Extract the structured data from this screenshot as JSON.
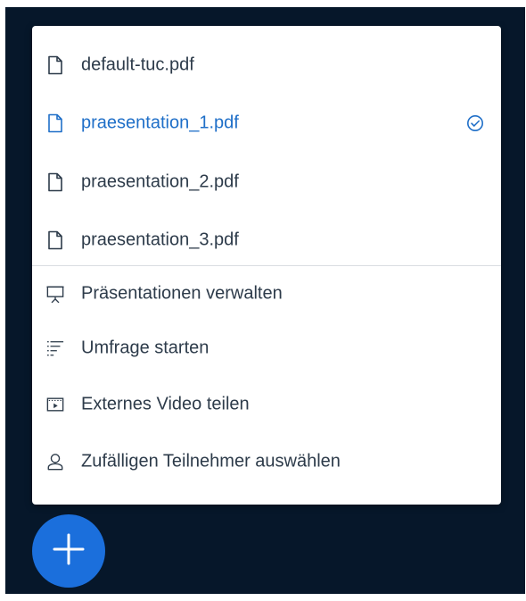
{
  "presentations": [
    {
      "name": "default-tuc.pdf",
      "icon": "file-icon",
      "active": false
    },
    {
      "name": "praesentation_1.pdf",
      "icon": "file-icon",
      "active": true,
      "status_icon": "check-circle-icon"
    },
    {
      "name": "praesentation_2.pdf",
      "icon": "file-icon",
      "active": false
    },
    {
      "name": "praesentation_3.pdf",
      "icon": "file-icon",
      "active": false
    }
  ],
  "actions": [
    {
      "label": "Präsentationen verwalten",
      "icon": "presentation-icon"
    },
    {
      "label": "Umfrage starten",
      "icon": "poll-icon"
    },
    {
      "label": "Externes Video teilen",
      "icon": "video-icon"
    },
    {
      "label": "Zufälligen Teilnehmer auswählen",
      "icon": "user-icon"
    }
  ],
  "fab": {
    "icon": "plus-icon"
  },
  "colors": {
    "background": "#06172a",
    "menu": "#ffffff",
    "text": "#2d3b4a",
    "accent": "#1f6fc8",
    "fab": "#1b6fdc"
  }
}
